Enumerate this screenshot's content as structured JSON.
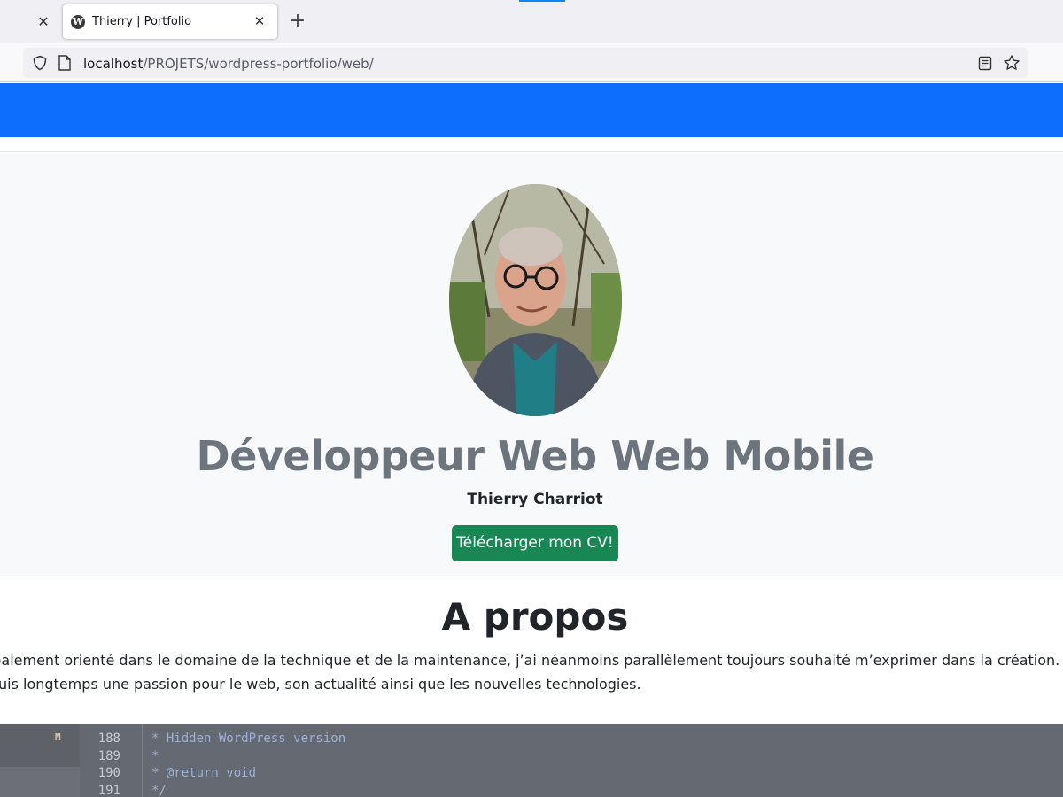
{
  "browser": {
    "tab_title": "Thierry | Portfolio",
    "tab_close_glyph": "✕",
    "prev_tab_close_glyph": "✕",
    "new_tab_glyph": "+",
    "url_host": "localhost",
    "url_path": "/PROJETS/wordpress-portfolio/web/",
    "icons": [
      "wordpress-favicon-icon",
      "shield-icon",
      "page-icon",
      "reader-view-icon",
      "bookmark-star-icon"
    ]
  },
  "hero": {
    "title": "Développeur Web Web Mobile",
    "name": "Thierry Charriot",
    "cv_button_label": "Télécharger mon CV!"
  },
  "about": {
    "title": "A propos",
    "line1": "cipalement orienté dans le domaine de la technique et de la maintenance, j’ai néanmoins parallèlement toujours souhaité m’exprimer dans la création.",
    "line2": "epuis longtemps une passion pour le web, son actualité ainsi que les nouvelles technologies."
  },
  "editor": {
    "status_marker": "M",
    "lines": [
      {
        "no": "188",
        "code": "* Hidden WordPress version"
      },
      {
        "no": "189",
        "code": "*"
      },
      {
        "no": "190",
        "code": "* @return void"
      },
      {
        "no": "191",
        "code": "*/"
      }
    ]
  },
  "colors": {
    "primary": "#0d6efd",
    "success": "#198754",
    "secondary_text": "#6c757d",
    "hero_bg": "#f8f9fa"
  }
}
